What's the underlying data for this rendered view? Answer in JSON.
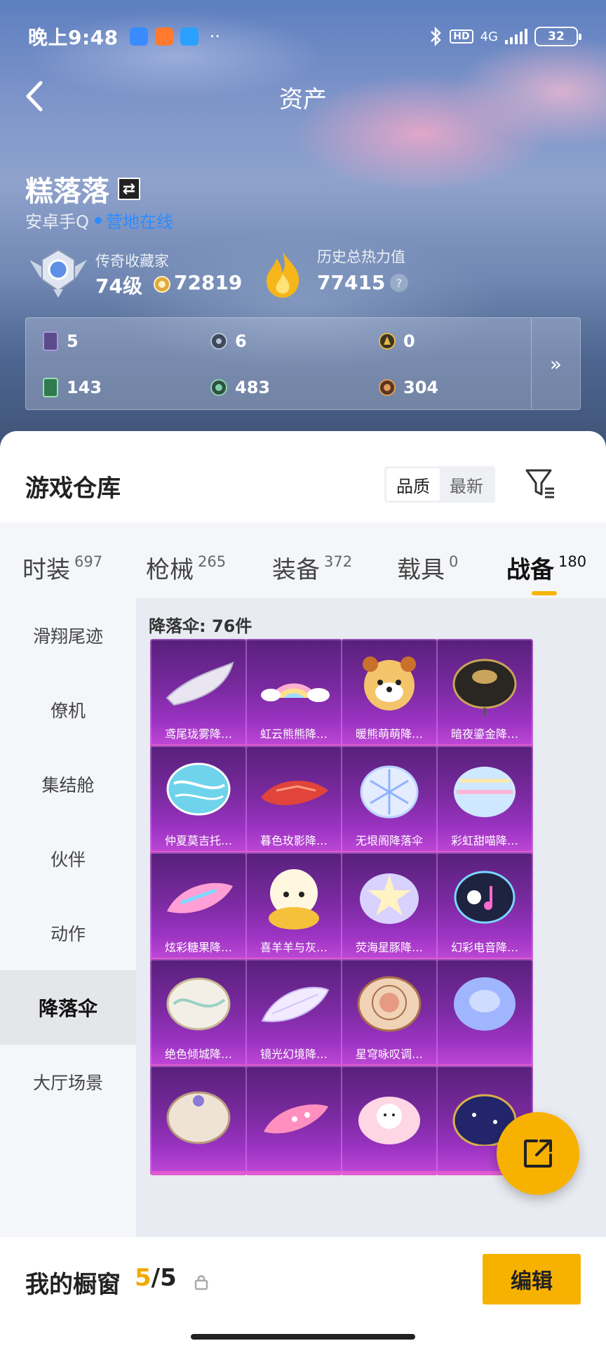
{
  "status_bar": {
    "time": "晚上9:48",
    "dots": "··",
    "hd": "HD",
    "network": "4G",
    "battery": "32"
  },
  "header": {
    "title": "资产"
  },
  "user": {
    "name": "糕落落",
    "platform": "安卓手Q",
    "online_status": "营地在线"
  },
  "rank": {
    "title": "传奇收藏家",
    "level": "74级",
    "coins": "72819"
  },
  "heat": {
    "label": "历史总热力值",
    "value": "77415",
    "help": "?"
  },
  "resources": [
    {
      "value": "5",
      "icon": "purple-card-icon"
    },
    {
      "value": "6",
      "icon": "silver-medal-icon"
    },
    {
      "value": "0",
      "icon": "gold-medal-icon"
    },
    {
      "value": "143",
      "icon": "green-card-icon"
    },
    {
      "value": "483",
      "icon": "green-orb-icon"
    },
    {
      "value": "304",
      "icon": "bronze-medal-icon"
    }
  ],
  "resource_expand": "»",
  "warehouse": {
    "title": "游戏仓库",
    "sort_options": [
      "品质",
      "最新"
    ],
    "sort_selected": "品质"
  },
  "categories": [
    {
      "label": "时装",
      "count": "697"
    },
    {
      "label": "枪械",
      "count": "265"
    },
    {
      "label": "装备",
      "count": "372"
    },
    {
      "label": "载具",
      "count": "0"
    },
    {
      "label": "战备",
      "count": "180",
      "active": true
    }
  ],
  "side_nav": [
    {
      "label": "滑翔尾迹"
    },
    {
      "label": "僚机"
    },
    {
      "label": "集结舱"
    },
    {
      "label": "伙伴"
    },
    {
      "label": "动作"
    },
    {
      "label": "降落伞",
      "active": true
    },
    {
      "label": "大厅场景"
    }
  ],
  "items_header": "降落伞: 76件",
  "items": [
    {
      "name": "鸢尾珑雾降…",
      "art": "glider-white"
    },
    {
      "name": "虹云熊熊降…",
      "art": "rainbow-fan"
    },
    {
      "name": "暖熊萌萌降…",
      "art": "red-panda"
    },
    {
      "name": "暗夜鎏金降…",
      "art": "dark-gold-dome"
    },
    {
      "name": "仲夏莫吉托…",
      "art": "cyan-dome"
    },
    {
      "name": "暮色玫影降…",
      "art": "red-glider"
    },
    {
      "name": "无垠阁降落伞",
      "art": "snowflake-dome"
    },
    {
      "name": "彩虹甜喵降…",
      "art": "pastel-dome"
    },
    {
      "name": "炫彩糖果降…",
      "art": "candy-glider"
    },
    {
      "name": "喜羊羊与灰…",
      "art": "sheep"
    },
    {
      "name": "荧海星豚降…",
      "art": "star-dome"
    },
    {
      "name": "幻彩电音降…",
      "art": "music-dome"
    },
    {
      "name": "绝色倾城降…",
      "art": "marble-dome"
    },
    {
      "name": "镜光幻境降…",
      "art": "mirror-glider"
    },
    {
      "name": "星穹咏叹调…",
      "art": "ornate-dome"
    },
    {
      "name": "",
      "art": "blue-rose-dome"
    },
    {
      "name": "",
      "art": "floral-dome"
    },
    {
      "name": "",
      "art": "pink-glider"
    },
    {
      "name": "",
      "art": "bunny-dome"
    },
    {
      "name": "",
      "art": "night-dome"
    }
  ],
  "showcase": {
    "label": "我的橱窗",
    "current": "5",
    "total": "/5",
    "edit_label": "编辑"
  },
  "colors": {
    "accent": "#f7b100",
    "card_purple": "#7a2aa0",
    "online_blue": "#2e8bff"
  }
}
